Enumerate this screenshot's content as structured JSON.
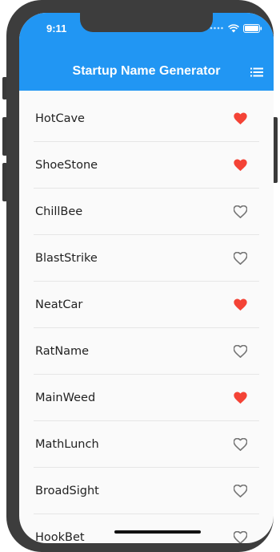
{
  "status_bar": {
    "time": "9:11",
    "icons": [
      "signal-dots-icon",
      "wifi-icon",
      "battery-icon"
    ]
  },
  "app_bar": {
    "title": "Startup Name Generator",
    "action_icon": "list-icon",
    "color": "#2196f3"
  },
  "colors": {
    "favorite": "#f44336",
    "unfavorite": "#757575"
  },
  "list": {
    "items": [
      {
        "label": "HotCave",
        "saved": true
      },
      {
        "label": "ShoeStone",
        "saved": true
      },
      {
        "label": "ChillBee",
        "saved": false
      },
      {
        "label": "BlastStrike",
        "saved": false
      },
      {
        "label": "NeatCar",
        "saved": true
      },
      {
        "label": "RatName",
        "saved": false
      },
      {
        "label": "MainWeed",
        "saved": true
      },
      {
        "label": "MathLunch",
        "saved": false
      },
      {
        "label": "BroadSight",
        "saved": false
      },
      {
        "label": "HookBet",
        "saved": false
      }
    ]
  }
}
